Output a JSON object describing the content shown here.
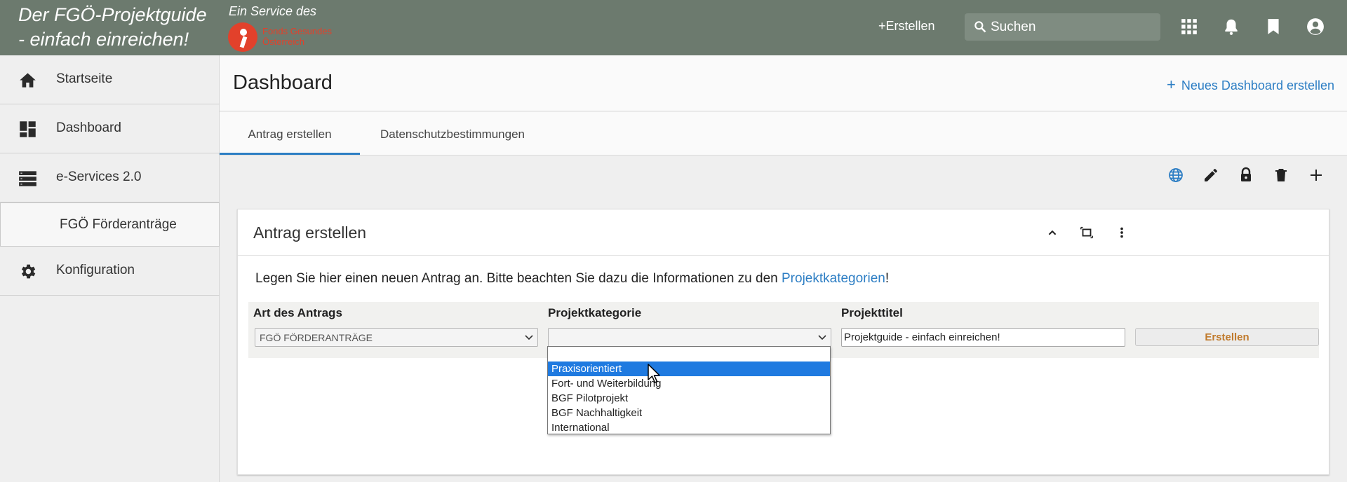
{
  "app": {
    "brand_line1": "Der FGÖ-Projektguide",
    "brand_line2": "- einfach einreichen!",
    "service_label": "Ein Service des",
    "logo_text_line1": "Fonds Gesundes",
    "logo_text_line2": "Österreich"
  },
  "topbar": {
    "create_label": "Erstellen",
    "search_placeholder": "Suchen",
    "icons": [
      "apps-grid-icon",
      "bell-icon",
      "bookmark-icon",
      "account-circle-icon"
    ]
  },
  "sidebar": {
    "items": [
      {
        "label": "Startseite",
        "icon": "home-icon"
      },
      {
        "label": "Dashboard",
        "icon": "dashboard-icon"
      },
      {
        "label": "e-Services 2.0",
        "icon": "list-icon"
      },
      {
        "label": "FGÖ Förderanträge"
      },
      {
        "label": "Konfiguration",
        "icon": "gear-icon"
      }
    ]
  },
  "main": {
    "title": "Dashboard",
    "new_dashboard_label": "Neues Dashboard erstellen",
    "tabs": [
      {
        "label": "Antrag erstellen",
        "active": true
      },
      {
        "label": "Datenschutzbestimmungen",
        "active": false
      }
    ],
    "action_icons": [
      "globe-icon",
      "pencil-icon",
      "lock-icon",
      "trash-icon",
      "plus-icon"
    ]
  },
  "card": {
    "title": "Antrag erstellen",
    "intro_text": "Legen Sie hier einen neuen Antrag an. Bitte beachten Sie dazu die Informationen zu den ",
    "intro_link": "Projektkategorien",
    "intro_end": "!",
    "form": {
      "art_label": "Art des Antrags",
      "art_value": "FGÖ FÖRDERANTRÄGE",
      "kategorie_label": "Projektkategorie",
      "kategorie_value": "",
      "titel_label": "Projekttitel",
      "titel_value": "Projektguide - einfach einreichen!",
      "submit_label": "Erstellen"
    }
  },
  "dropdown": {
    "options": [
      "",
      "Praxisorientiert",
      "Fort- und Weiterbildung",
      "BGF Pilotprojekt",
      "BGF Nachhaltigkeit",
      "International"
    ],
    "highlighted": "Praxisorientiert"
  },
  "colors": {
    "topbar": "#6c7a6e",
    "accent": "#2d7ec4",
    "logo_red": "#e2412b",
    "highlight": "#1f7ae0"
  }
}
